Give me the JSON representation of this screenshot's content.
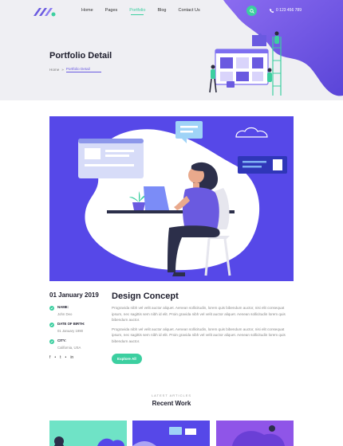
{
  "nav": {
    "items": [
      {
        "label": "Home",
        "active": false
      },
      {
        "label": "Pages",
        "active": false
      },
      {
        "label": "Portfolio",
        "active": true
      },
      {
        "label": "Blog",
        "active": false
      },
      {
        "label": "Contact Us",
        "active": false
      }
    ],
    "phone": "0 123 456 789"
  },
  "hero": {
    "title": "Portfolio Detail",
    "breadcrumb": {
      "home": "Home",
      "separator": "»",
      "current": "Portfolio Detail"
    }
  },
  "details": {
    "date": "01 January 2019",
    "fields": [
      {
        "label": "NAME:",
        "value": "John Deo"
      },
      {
        "label": "DATE OF BIRTH:",
        "value": "01 January 1990"
      },
      {
        "label": "CITY:",
        "value": "California, USA"
      }
    ],
    "socials": [
      "f",
      "•",
      "t",
      "•",
      "in"
    ]
  },
  "content": {
    "title": "Design Concept",
    "paragraphs": [
      "Progravida nibh vel velit auctor aliquet. Aenean sollicitudin, lorem quis bibendum auctor, nisi elit consequat ipsum, nec sagittis sem nibh id elit. Proin gravida nibh vel velit auctor aliquet. Aenean sollicitudin lorem quis bibendum auctor.",
      "Progravida nibh vel velit auctor aliquet. Aenean sollicitudin, lorem quis bibendum auctor, nisi elit consequat ipsum, nec sagittis sem nibh id elit. Proin gravida nibh vel velit auctor aliquet. Aenean sollicitudin lorem quis bibendum auctor."
    ],
    "button_label": "Explore All"
  },
  "recent": {
    "kicker": "LATEST ARTICLES",
    "title": "Recent Work"
  },
  "colors": {
    "accent": "#3ccfa0",
    "brand": "#6a5ae0",
    "illustration_bg": "#5648e8"
  }
}
